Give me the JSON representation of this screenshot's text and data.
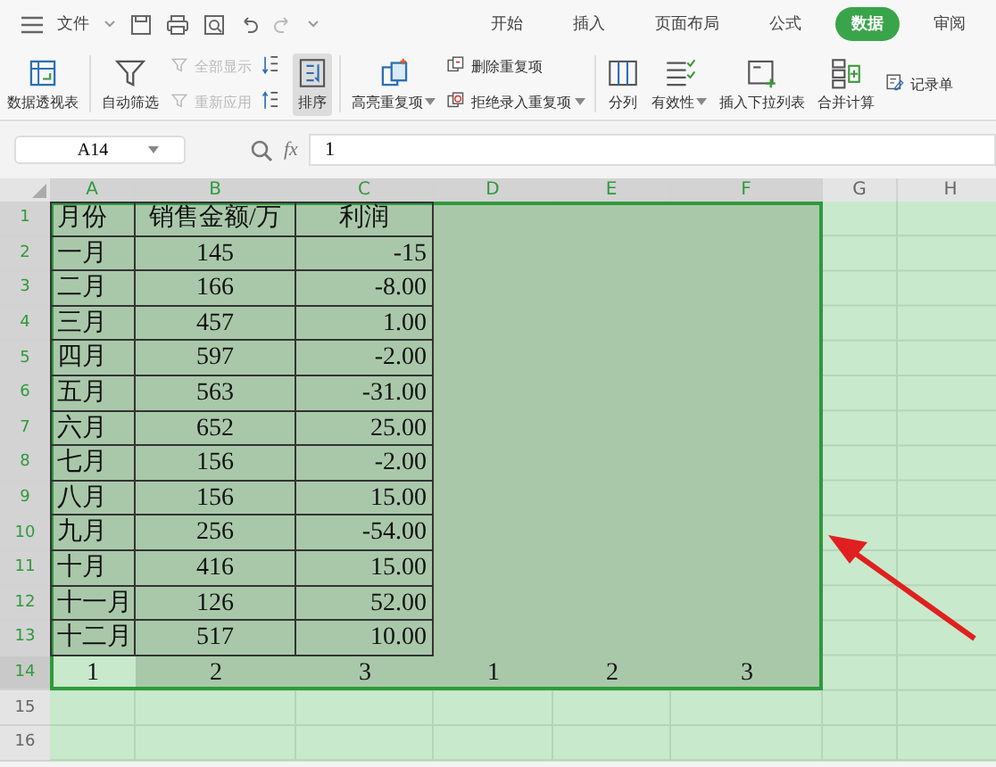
{
  "menu": {
    "file": "文件",
    "tabs": [
      {
        "label": "开始",
        "selected": false
      },
      {
        "label": "插入",
        "selected": false
      },
      {
        "label": "页面布局",
        "selected": false
      },
      {
        "label": "公式",
        "selected": false
      },
      {
        "label": "数据",
        "selected": true
      },
      {
        "label": "审阅",
        "selected": false
      }
    ]
  },
  "ribbon": [
    [
      {
        "items": [
          {
            "label": "数据透视表",
            "kind": "large",
            "disabled": false,
            "pressed": false,
            "menu": false
          }
        ]
      }
    ],
    [
      {
        "items": [
          {
            "label": "自动筛选",
            "kind": "large",
            "disabled": false,
            "pressed": false,
            "menu": false
          }
        ]
      },
      {
        "items": [
          {
            "label": "全部显示",
            "kind": "small",
            "disabled": true,
            "pressed": false,
            "menu": false
          },
          {
            "label": "重新应用",
            "kind": "small",
            "disabled": true,
            "pressed": false,
            "menu": false
          }
        ]
      },
      {
        "items": [
          {
            "kind": "icon",
            "disabled": false,
            "pressed": false,
            "menu": false
          },
          {
            "kind": "icon",
            "disabled": false,
            "pressed": false,
            "menu": false
          }
        ]
      },
      {
        "items": [
          {
            "label": "排序",
            "kind": "large",
            "disabled": false,
            "pressed": true,
            "menu": false
          }
        ]
      }
    ],
    [
      {
        "items": [
          {
            "label": "高亮重复项",
            "kind": "large",
            "disabled": false,
            "pressed": false,
            "menu": true
          }
        ]
      },
      {
        "items": [
          {
            "label": "删除重复项",
            "kind": "small",
            "disabled": false,
            "pressed": false,
            "menu": false
          },
          {
            "label": "拒绝录入重复项",
            "kind": "small",
            "disabled": false,
            "pressed": false,
            "menu": true
          }
        ]
      }
    ],
    [
      {
        "items": [
          {
            "label": "分列",
            "kind": "large",
            "disabled": false,
            "pressed": false,
            "menu": false
          }
        ]
      },
      {
        "items": [
          {
            "label": "有效性",
            "kind": "large",
            "disabled": false,
            "pressed": false,
            "menu": true
          }
        ]
      },
      {
        "items": [
          {
            "label": "插入下拉列表",
            "kind": "large",
            "disabled": false,
            "pressed": false,
            "menu": false
          }
        ]
      },
      {
        "items": [
          {
            "label": "合并计算",
            "kind": "large",
            "disabled": false,
            "pressed": false,
            "menu": false
          }
        ]
      },
      {
        "items": [
          {
            "label": "记录单",
            "kind": "small",
            "disabled": false,
            "pressed": false,
            "menu": false
          }
        ]
      }
    ]
  ],
  "formula_bar": {
    "name_box": "A14",
    "fx": "fx",
    "value": "1"
  },
  "sheet": {
    "columns": [
      {
        "label": "A",
        "selected": true
      },
      {
        "label": "B",
        "selected": true
      },
      {
        "label": "C",
        "selected": true
      },
      {
        "label": "D",
        "selected": true
      },
      {
        "label": "E",
        "selected": true
      },
      {
        "label": "F",
        "selected": true
      },
      {
        "label": "G",
        "selected": false
      },
      {
        "label": "H",
        "selected": false
      }
    ],
    "rows": [
      {
        "header": "1",
        "selected": true,
        "active": false,
        "bordered": true,
        "cells": [
          "月份",
          "销售金额/万",
          "利润",
          "",
          "",
          "",
          "",
          ""
        ]
      },
      {
        "header": "2",
        "selected": true,
        "active": false,
        "bordered": true,
        "cells": [
          "一月",
          "145",
          "-15",
          "",
          "",
          "",
          "",
          ""
        ]
      },
      {
        "header": "3",
        "selected": true,
        "active": false,
        "bordered": true,
        "cells": [
          "二月",
          "166",
          "-8.00",
          "",
          "",
          "",
          "",
          ""
        ]
      },
      {
        "header": "4",
        "selected": true,
        "active": false,
        "bordered": true,
        "cells": [
          "三月",
          "457",
          "1.00",
          "",
          "",
          "",
          "",
          ""
        ]
      },
      {
        "header": "5",
        "selected": true,
        "active": false,
        "bordered": true,
        "cells": [
          "四月",
          "597",
          "-2.00",
          "",
          "",
          "",
          "",
          ""
        ]
      },
      {
        "header": "6",
        "selected": true,
        "active": false,
        "bordered": true,
        "cells": [
          "五月",
          "563",
          "-31.00",
          "",
          "",
          "",
          "",
          ""
        ]
      },
      {
        "header": "7",
        "selected": true,
        "active": false,
        "bordered": true,
        "cells": [
          "六月",
          "652",
          "25.00",
          "",
          "",
          "",
          "",
          ""
        ]
      },
      {
        "header": "8",
        "selected": true,
        "active": false,
        "bordered": true,
        "cells": [
          "七月",
          "156",
          "-2.00",
          "",
          "",
          "",
          "",
          ""
        ]
      },
      {
        "header": "9",
        "selected": true,
        "active": false,
        "bordered": true,
        "cells": [
          "八月",
          "156",
          "15.00",
          "",
          "",
          "",
          "",
          ""
        ]
      },
      {
        "header": "10",
        "selected": true,
        "active": false,
        "bordered": true,
        "cells": [
          "九月",
          "256",
          "-54.00",
          "",
          "",
          "",
          "",
          ""
        ]
      },
      {
        "header": "11",
        "selected": true,
        "active": false,
        "bordered": true,
        "cells": [
          "十月",
          "416",
          "15.00",
          "",
          "",
          "",
          "",
          ""
        ]
      },
      {
        "header": "12",
        "selected": true,
        "active": false,
        "bordered": true,
        "cells": [
          "十一月",
          "126",
          "52.00",
          "",
          "",
          "",
          "",
          ""
        ]
      },
      {
        "header": "13",
        "selected": true,
        "active": false,
        "bordered": true,
        "cells": [
          "十二月",
          "517",
          "10.00",
          "",
          "",
          "",
          "",
          ""
        ]
      },
      {
        "header": "14",
        "selected": true,
        "active": true,
        "bordered": false,
        "cells": [
          "1",
          "2",
          "3",
          "1",
          "2",
          "3",
          "",
          ""
        ]
      },
      {
        "header": "15",
        "selected": false,
        "active": false,
        "bordered": false,
        "cells": [
          "",
          "",
          "",
          "",
          "",
          "",
          "",
          ""
        ]
      },
      {
        "header": "16",
        "selected": false,
        "active": false,
        "bordered": false,
        "cells": [
          "",
          "",
          "",
          "",
          "",
          "",
          "",
          ""
        ]
      }
    ]
  }
}
